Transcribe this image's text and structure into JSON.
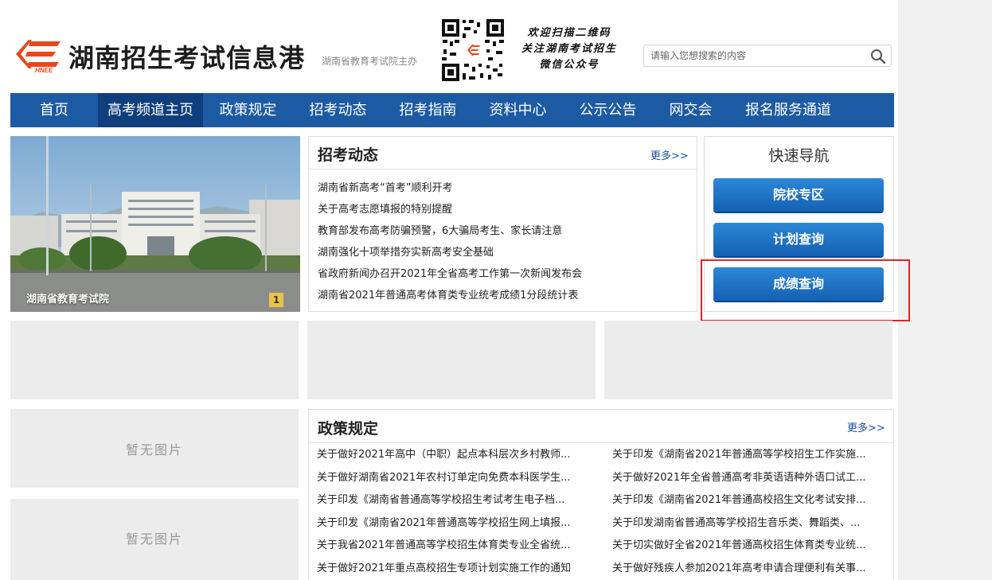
{
  "header": {
    "site_title": "湖南招生考试信息港",
    "site_subtitle": "湖南省教育考试院主办",
    "logo_text": "HNEE",
    "qr_text": [
      "欢迎扫描二维码",
      "关注湖南考试招生",
      "微信公众号"
    ],
    "search_placeholder": "请输入您想搜索的内容"
  },
  "nav": {
    "items": [
      "首页",
      "高考频道主页",
      "政策规定",
      "招考动态",
      "招考指南",
      "资料中心",
      "公示公告",
      "网交会",
      "报名服务通道"
    ],
    "active_index": 1
  },
  "banner": {
    "caption": "湖南省教育考试院",
    "page_number": "1"
  },
  "news": {
    "title": "招考动态",
    "more": "更多>>",
    "items": [
      "湖南省新高考“首考”顺利开考",
      "关于高考志愿填报的特别提醒",
      "教育部发布高考防骗预警，6大骗局考生、家长请注意",
      "湖南强化十项举措夯实新高考安全基础",
      "省政府新闻办召开2021年全省高考工作第一次新闻发布会",
      "湖南省2021年普通高考体育类专业统考成绩1分段统计表"
    ]
  },
  "quick_nav": {
    "title": "快速导航",
    "buttons": [
      "院校专区",
      "计划查询",
      "成绩查询"
    ]
  },
  "placeholders": {
    "no_image": "暂无图片"
  },
  "policy": {
    "title": "政策规定",
    "more": "更多>>",
    "left": [
      "关于做好2021年高中（中职）起点本科层次乡村教师...",
      "关于做好湖南省2021年农村订单定向免费本科医学生...",
      "关于印发《湖南省普通高等学校招生考试考生电子档...",
      "关于印发《湖南省2021年普通高等学校招生网上填报...",
      "关于我省2021年普通高等学校招生体育类专业全省统...",
      "关于做好2021年重点高校招生专项计划实施工作的通知"
    ],
    "right": [
      "关于印发《湖南省2021年普通高等学校招生工作实施...",
      "关于做好2021年全省普通高考非英语语种外语口试工...",
      "关于印发《湖南省2021年普通高校招生文化考试安排...",
      "关于印发湖南省普通高等学校招生音乐类、舞蹈类、...",
      "关于切实做好全省2021年普通高校招生体育类专业统...",
      "关于做好残疾人参加2021年高考申请合理便利有关事..."
    ]
  },
  "colors": {
    "nav_bg": "#1c5aa3",
    "nav_active": "#0e3e7c",
    "logo": "#e8471c",
    "link": "#1c4fa0",
    "highlight": "#e02424"
  }
}
